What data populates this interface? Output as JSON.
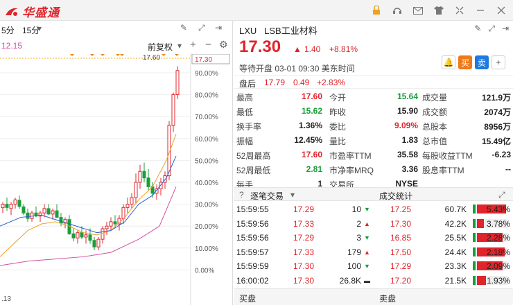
{
  "app": {
    "logo_text": "华盛通"
  },
  "left": {
    "period1": "5分",
    "period2": "15分",
    "adjust": "前复权",
    "price_tag_left": "12.15",
    "high_label": "17.60",
    "price_axis_label": "17.30",
    "pct_ticks": [
      "90.00%",
      "80.00%",
      "70.00%",
      "60.00%",
      "50.00%",
      "40.00%",
      "30.00%",
      "20.00%",
      "10.00%",
      "0.00%"
    ],
    "bottom_label": ".13"
  },
  "stock": {
    "code": "LXU",
    "name": "LSB工业材料",
    "price": "17.30",
    "change": "1.40",
    "change_pct": "+8.81%",
    "status": "等待开盘 03-01 09:30 美东时间",
    "buy_label": "买",
    "sell_label": "卖"
  },
  "after_hours": {
    "label": "盘后",
    "price": "17.79",
    "change": "0.49",
    "change_pct": "+2.83%"
  },
  "stats": [
    [
      "最高",
      "17.60",
      "今开",
      "15.64",
      "成交量",
      "121.9万"
    ],
    [
      "最低",
      "15.62",
      "昨收",
      "15.90",
      "成交额",
      "2074万"
    ],
    [
      "换手率",
      "1.36%",
      "委比",
      "9.09%",
      "总股本",
      "8956万"
    ],
    [
      "振幅",
      "12.45%",
      "量比",
      "1.83",
      "总市值",
      "15.49亿"
    ],
    [
      "52周最高",
      "17.60",
      "市盈率TTM",
      "35.58",
      "每股收益TTM",
      "-6.23"
    ],
    [
      "52周最低",
      "2.81",
      "市净率MRQ",
      "3.36",
      "股息率TTM",
      "--"
    ],
    [
      "每手",
      "1",
      "交易所",
      "NYSE",
      "",
      ""
    ]
  ],
  "section": {
    "left_title": "逐笔交易",
    "right_title": "成交统计"
  },
  "trades": [
    {
      "time": "15:59:55",
      "price": "17.29",
      "vol": "10",
      "dir": "down"
    },
    {
      "time": "15:59:56",
      "price": "17.33",
      "vol": "2",
      "dir": "up"
    },
    {
      "time": "15:59:56",
      "price": "17.29",
      "vol": "3",
      "dir": "down"
    },
    {
      "time": "15:59:57",
      "price": "17.33",
      "vol": "179",
      "dir": "up"
    },
    {
      "time": "15:59:59",
      "price": "17.30",
      "vol": "100",
      "dir": "down"
    },
    {
      "time": "16:00:02",
      "price": "17.30",
      "vol": "26.8K",
      "dir": "flat"
    }
  ],
  "volume_stats": [
    {
      "price": "17.25",
      "vol": "60.7K",
      "pct": "5.43%",
      "ratio": 0.95
    },
    {
      "price": "17.30",
      "vol": "42.2K",
      "pct": "3.78%",
      "ratio": 0.22
    },
    {
      "price": "16.85",
      "vol": "25.5K",
      "pct": "2.28%",
      "ratio": 0.85
    },
    {
      "price": "17.50",
      "vol": "24.4K",
      "pct": "2.18%",
      "ratio": 0.9
    },
    {
      "price": "17.29",
      "vol": "23.3K",
      "pct": "2.09%",
      "ratio": 0.85
    },
    {
      "price": "17.20",
      "vol": "21.5K",
      "pct": "1.93%",
      "ratio": 0.3
    }
  ],
  "bottom": {
    "buy_label": "买盘",
    "sell_label": "卖盘"
  }
}
